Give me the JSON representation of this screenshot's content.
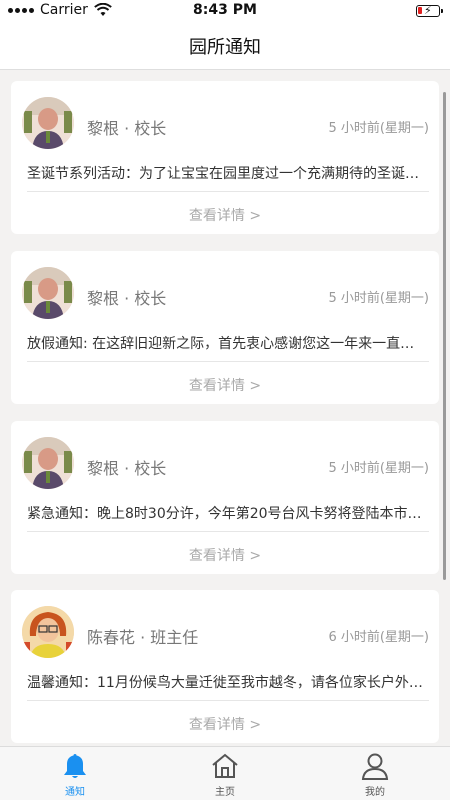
{
  "status_bar": {
    "carrier": "Carrier",
    "time": "8:43 PM"
  },
  "nav": {
    "title": "园所通知"
  },
  "notices": [
    {
      "author": "黎根 · 校长",
      "time": "5 小时前(星期一)",
      "summary": "圣诞节系列活动：为了让宝宝在园里度过一个充满期待的圣诞节…",
      "details": "查看详情 >",
      "avatar": "principal"
    },
    {
      "author": "黎根 · 校长",
      "time": "5 小时前(星期一)",
      "summary": "放假通知: 在这辞旧迎新之际，首先衷心感谢您这一年来一直的…",
      "details": "查看详情 >",
      "avatar": "principal"
    },
    {
      "author": "黎根 · 校长",
      "time": "5 小时前(星期一)",
      "summary": "紧急通知：晚上8时30分许，今年第20号台风卡努将登陆本市…",
      "details": "查看详情 >",
      "avatar": "principal"
    },
    {
      "author": "陈春花 · 班主任",
      "time": "6 小时前(星期一)",
      "summary": "温馨通知：11月份候鸟大量迁徙至我市越冬，请各位家长户外…",
      "details": "查看详情 >",
      "avatar": "teacher"
    }
  ],
  "tabs": [
    {
      "label": "通知",
      "icon": "bell-icon",
      "active": true
    },
    {
      "label": "主页",
      "icon": "home-icon",
      "active": false
    },
    {
      "label": "我的",
      "icon": "person-icon",
      "active": false
    }
  ],
  "colors": {
    "accent": "#1a90f0",
    "background": "#f3f2f1",
    "card": "#ffffff"
  }
}
